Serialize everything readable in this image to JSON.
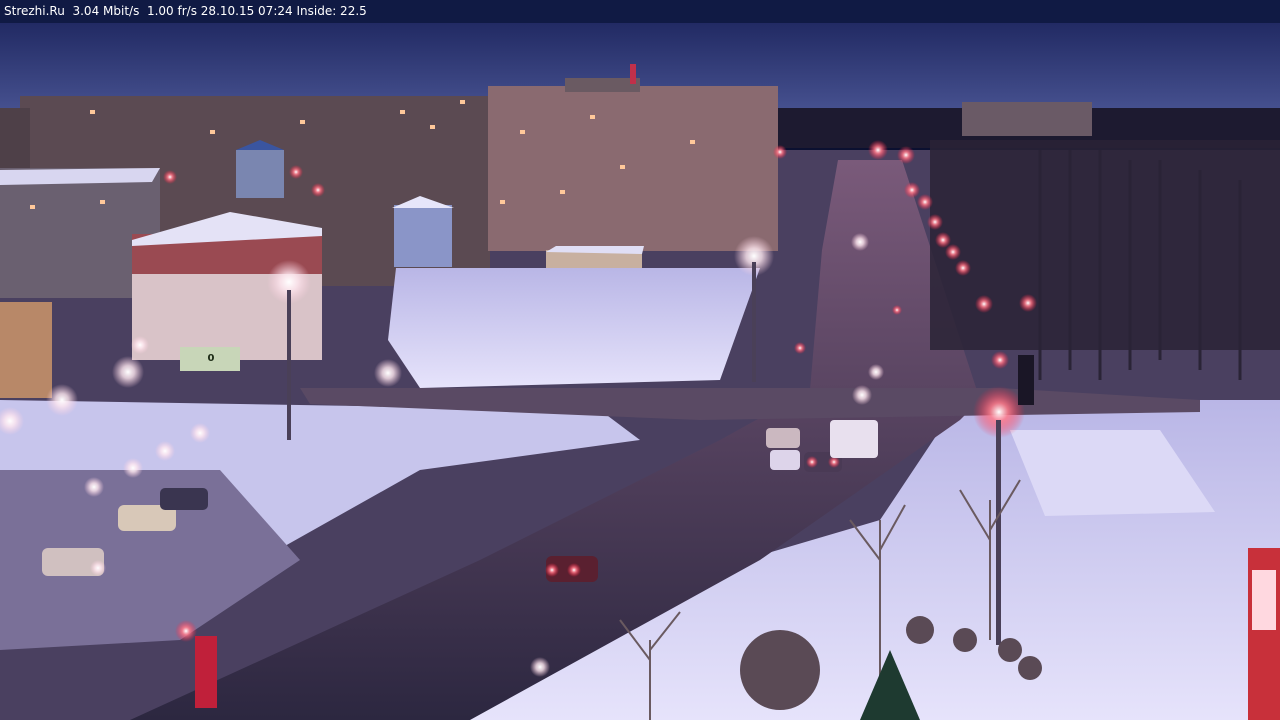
{
  "overlay": {
    "site": "Strezhi.Ru",
    "bitrate": "3.04 Mbit/s",
    "framerate": "1.00 fr/s",
    "datetime": "28.10.15 07:24",
    "inside_temp": "Inside: 22.5"
  },
  "scene": {
    "billboard_text": "0",
    "colors": {
      "sky_top": "#1b2155",
      "sky_bottom": "#3a4a8a",
      "snow": "#c9c8ee",
      "road": "#3b3550",
      "lamp_glow": "#ffffff",
      "red_light": "#ff3a4a"
    }
  }
}
